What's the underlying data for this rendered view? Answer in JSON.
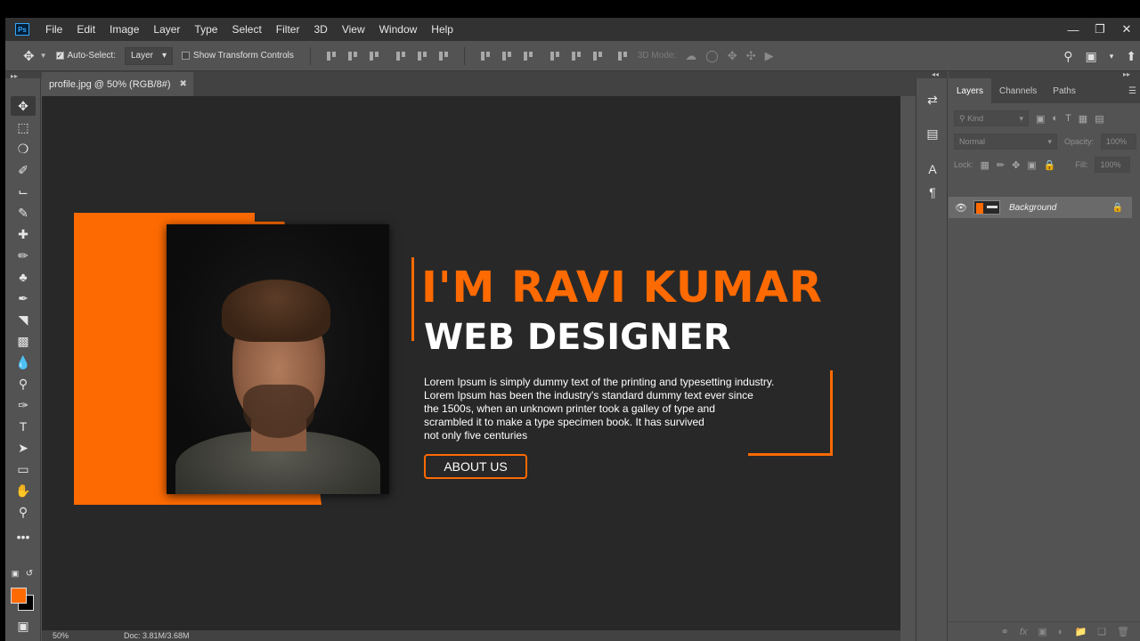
{
  "menubar": {
    "logo": "Ps",
    "items": [
      "File",
      "Edit",
      "Image",
      "Layer",
      "Type",
      "Select",
      "Filter",
      "3D",
      "View",
      "Window",
      "Help"
    ],
    "window_controls": [
      "minimize-icon",
      "restore-icon",
      "close-icon"
    ]
  },
  "options": {
    "auto_select_label": "Auto-Select:",
    "auto_select_checked": true,
    "auto_select_target": "Layer",
    "transform_label": "Show Transform Controls",
    "transform_checked": false,
    "mode_3d_label": "3D Mode:"
  },
  "document": {
    "tab_title": "profile.jpg @ 50% (RGB/8#)",
    "zoom": "50%",
    "doc_info": "Doc: 3.81M/3.68M"
  },
  "design": {
    "headline": "I'M RAVI KUMAR",
    "subheadline": "WEB DESIGNER",
    "body": "Lorem Ipsum is simply dummy text of the printing and typesetting industry.\nLorem Ipsum has been the industry's standard dummy text ever since\nthe 1500s, when an unknown printer took a galley of type and\nscrambled it to make a type specimen book. It has survived\nnot only five centuries",
    "button_label": "ABOUT US",
    "accent_color": "#fd6a02"
  },
  "colors": {
    "foreground": "#fd6a02",
    "background": "#000000"
  },
  "layers_panel": {
    "tabs": [
      "Layers",
      "Channels",
      "Paths"
    ],
    "active_tab": "Layers",
    "filter_placeholder": "Kind",
    "blend_mode": "Normal",
    "opacity_label": "Opacity:",
    "opacity_value": "100%",
    "lock_label": "Lock:",
    "fill_label": "Fill:",
    "fill_value": "100%",
    "layers": [
      {
        "name": "Background",
        "visible": true,
        "locked": true
      }
    ]
  }
}
